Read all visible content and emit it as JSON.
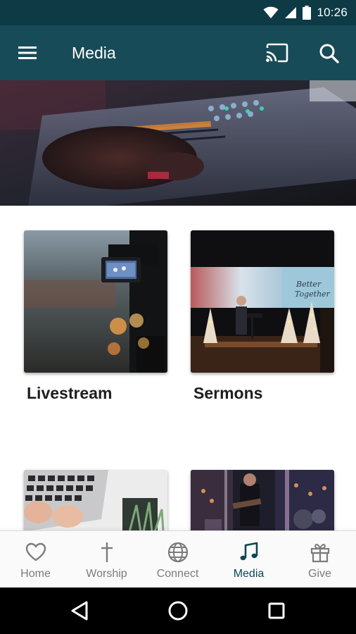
{
  "status_bar": {
    "time": "10:26",
    "icons": [
      "wifi-icon",
      "cell-signal-icon",
      "battery-icon"
    ]
  },
  "app_bar": {
    "title": "Media",
    "icons": {
      "menu": "menu-icon",
      "cast": "cast-icon",
      "search": "search-icon"
    }
  },
  "hero": {
    "alt": "Audio mixing console"
  },
  "grid": {
    "items": [
      {
        "label": "Livestream",
        "image": "camera-livestream-photo"
      },
      {
        "label": "Sermons",
        "image": "stage-sermon-photo",
        "image_text": "Better Together"
      },
      {
        "label": "",
        "image": "laptop-typing-photo"
      },
      {
        "label": "",
        "image": "band-stage-photo"
      }
    ]
  },
  "bottom_nav": {
    "active": "Media",
    "items": [
      {
        "label": "Home",
        "icon": "heart-icon"
      },
      {
        "label": "Worship",
        "icon": "cross-icon"
      },
      {
        "label": "Connect",
        "icon": "globe-icon"
      },
      {
        "label": "Media",
        "icon": "music-note-icon"
      },
      {
        "label": "Give",
        "icon": "gift-icon"
      }
    ]
  },
  "system_nav": {
    "buttons": [
      "back-icon",
      "home-circle-icon",
      "recents-icon"
    ]
  },
  "colors": {
    "status_bar": "#0d3a45",
    "app_bar": "#174b57",
    "nav_active": "#0f4652",
    "nav_inactive": "#7b7b7b"
  }
}
